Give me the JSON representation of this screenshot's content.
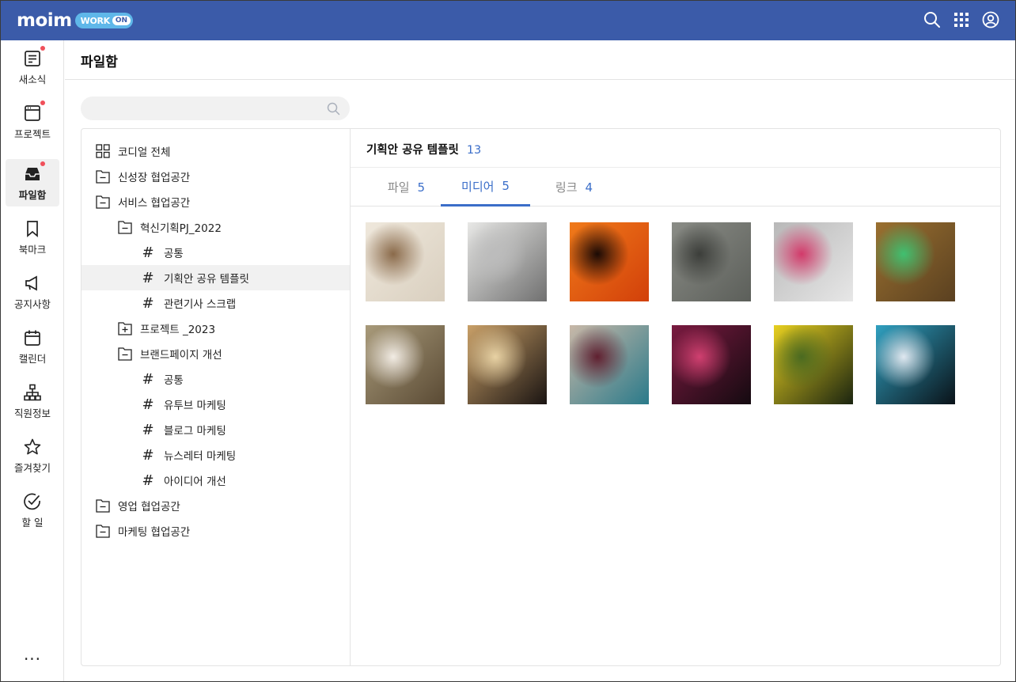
{
  "app": {
    "logo_text": "moim",
    "logo_work": "WORK",
    "logo_on": "ON"
  },
  "header_icons": [
    "search-icon",
    "apps-grid-icon",
    "account-icon"
  ],
  "nav": [
    {
      "id": "news",
      "label": "새소식",
      "icon": "news-icon",
      "badge": true
    },
    {
      "id": "project",
      "label": "프로젝트",
      "icon": "project-icon",
      "badge": true
    },
    {
      "id": "files",
      "label": "파일함",
      "icon": "inbox-icon",
      "badge": true,
      "active": true
    },
    {
      "id": "bookmark",
      "label": "북마크",
      "icon": "bookmark-icon",
      "badge": false
    },
    {
      "id": "notice",
      "label": "공지사항",
      "icon": "megaphone-icon",
      "badge": false
    },
    {
      "id": "calendar",
      "label": "캘린더",
      "icon": "calendar-icon",
      "badge": false
    },
    {
      "id": "org",
      "label": "직원정보",
      "icon": "org-chart-icon",
      "badge": false
    },
    {
      "id": "favorites",
      "label": "즐겨찾기",
      "icon": "star-icon",
      "badge": false
    },
    {
      "id": "todo",
      "label": "할 일",
      "icon": "check-circle-icon",
      "badge": false
    }
  ],
  "more_label": "...",
  "page": {
    "title": "파일함",
    "search_placeholder": ""
  },
  "tree": [
    {
      "label": "코디얼 전체",
      "type": "all",
      "level": 0
    },
    {
      "label": "신성장 협업공간",
      "type": "minus",
      "level": 0
    },
    {
      "label": "서비스 협업공간",
      "type": "minus",
      "level": 0
    },
    {
      "label": "혁신기획PJ_2022",
      "type": "minus",
      "level": 1
    },
    {
      "label": "공통",
      "type": "hash",
      "level": 2
    },
    {
      "label": "기획안 공유 템플릿",
      "type": "hash",
      "level": 2,
      "selected": true
    },
    {
      "label": "관련기사 스크랩",
      "type": "hash",
      "level": 2
    },
    {
      "label": "프로젝트 _2023",
      "type": "plus",
      "level": 1
    },
    {
      "label": "브랜드페이지 개선",
      "type": "minus",
      "level": 1
    },
    {
      "label": "공통",
      "type": "hash",
      "level": 2
    },
    {
      "label": "유투브 마케팅",
      "type": "hash",
      "level": 2
    },
    {
      "label": "블로그 마케팅",
      "type": "hash",
      "level": 2
    },
    {
      "label": "뉴스레터 마케팅",
      "type": "hash",
      "level": 2
    },
    {
      "label": "아이디어 개선",
      "type": "hash",
      "level": 2
    },
    {
      "label": "영업 협업공간",
      "type": "minus",
      "level": 0
    },
    {
      "label": "마케팅 협업공간",
      "type": "minus",
      "level": 0
    }
  ],
  "content": {
    "title": "기획안 공유 템플릿",
    "count": "13",
    "tabs": [
      {
        "label": "파일",
        "count": "5"
      },
      {
        "label": "미디어",
        "count": "5",
        "active": true
      },
      {
        "label": "링크",
        "count": "4"
      }
    ]
  },
  "media": [
    {
      "name": "coffee-photo",
      "colors": [
        "#d9cfbf",
        "#efe8dc",
        "#8a6a4a"
      ]
    },
    {
      "name": "laptop-bed-photo",
      "colors": [
        "#707070",
        "#e8e8e6",
        "#bcbcbc"
      ]
    },
    {
      "name": "sunset-pylon-photo",
      "colors": [
        "#d2400a",
        "#f07a1a",
        "#1a0a05"
      ]
    },
    {
      "name": "cobblestone-photo",
      "colors": [
        "#5c5f5a",
        "#8a8c86",
        "#3c3e3a"
      ]
    },
    {
      "name": "desk-monitor-photo",
      "colors": [
        "#e7e7e7",
        "#b8b8b8",
        "#d23a6a"
      ]
    },
    {
      "name": "cave-photo",
      "colors": [
        "#5a4020",
        "#9a7030",
        "#40c070"
      ]
    },
    {
      "name": "blossom-photo",
      "colors": [
        "#5a4a34",
        "#a89a7a",
        "#f2ece4"
      ]
    },
    {
      "name": "night-street-photo",
      "colors": [
        "#1a1412",
        "#c9a068",
        "#e8d2a4"
      ]
    },
    {
      "name": "abstract-paint-photo",
      "colors": [
        "#2a7a8a",
        "#c8b8a8",
        "#602030"
      ]
    },
    {
      "name": "dark-leaf-photo",
      "colors": [
        "#140a10",
        "#7a1a40",
        "#d04070"
      ]
    },
    {
      "name": "tulips-photo",
      "colors": [
        "#1a2410",
        "#e8d020",
        "#4a6a20"
      ]
    },
    {
      "name": "shop-night-photo",
      "colors": [
        "#0a1218",
        "#30a0c0",
        "#e0e8f0"
      ]
    }
  ],
  "colors": {
    "brand": "#3b5ba9",
    "accent": "#3b6ec9",
    "badge": "#f0505a"
  }
}
